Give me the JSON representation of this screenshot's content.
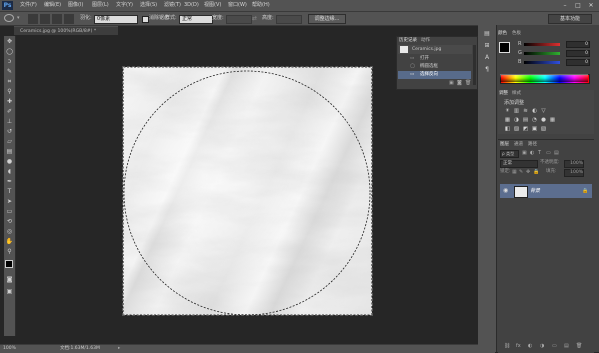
{
  "app": {
    "logo": "Ps"
  },
  "menubar": {
    "items": [
      "文件(F)",
      "编辑(E)",
      "图像(I)",
      "图层(L)",
      "文字(Y)",
      "选择(S)",
      "滤镜(T)",
      "3D(D)",
      "视图(V)",
      "窗口(W)",
      "帮助(H)"
    ],
    "window_controls": [
      "–",
      "□",
      "✕"
    ]
  },
  "options": {
    "feather_label": "羽化:",
    "feather_value": "0像素",
    "antialias_label": "消除锯齿",
    "style_label": "样式:",
    "style_value": "正常",
    "width_label": "宽度:",
    "height_label": "高度:",
    "refine_button": "调整边缘...",
    "workspace": "基本功能"
  },
  "document": {
    "tab_title": "Ceramics.jpg @ 100%(RGB/8#) *",
    "tab_close": "×"
  },
  "statusbar": {
    "zoom": "100%",
    "doc_info": "文档:1.63M/1.63M"
  },
  "history": {
    "tabs": [
      "历史记录",
      "动作"
    ],
    "snapshot": "Ceramics.jpg",
    "steps": [
      "打开",
      "椭圆选框",
      "选择反向"
    ]
  },
  "color_panel": {
    "tabs": [
      "颜色",
      "色板"
    ],
    "channels": [
      {
        "label": "R",
        "value": "0",
        "color": "#e03030"
      },
      {
        "label": "G",
        "value": "0",
        "color": "#30b030"
      },
      {
        "label": "B",
        "value": "0",
        "color": "#3050e0"
      }
    ]
  },
  "adjustments": {
    "tabs": [
      "调整",
      "样式"
    ],
    "title": "添加调整",
    "row1": [
      "☀",
      "▥",
      "≋",
      "◐",
      "▽"
    ],
    "row2": [
      "▦",
      "◑",
      "▤",
      "◔",
      "●",
      "▦"
    ],
    "row3": [
      "◧",
      "▨",
      "◩",
      "▣",
      "▧"
    ]
  },
  "layers": {
    "tabs": [
      "图层",
      "通道",
      "路径"
    ],
    "blend_mode": "正常",
    "opacity_label": "不透明度:",
    "opacity": "100%",
    "lock_label": "锁定:",
    "fill_label": "填充:",
    "fill": "100%",
    "layer_name": "背景",
    "footer_icons": [
      "⛓",
      "fx",
      "◐",
      "◑",
      "▭",
      "▤",
      "🗑"
    ]
  },
  "colors": {
    "accent": "#5c6e8f",
    "panel": "#424242",
    "chrome": "#535353",
    "canvas_bg": "#262626"
  }
}
